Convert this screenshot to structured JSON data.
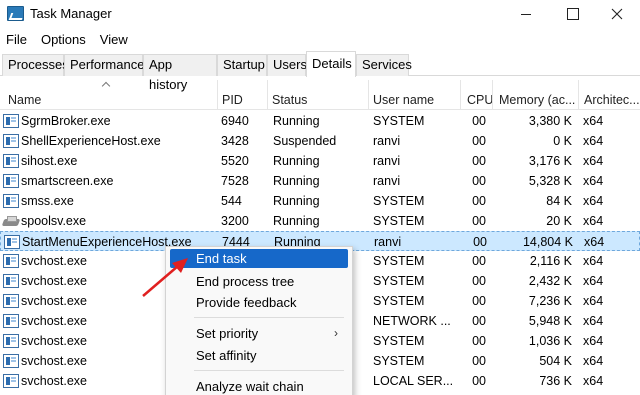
{
  "window": {
    "title": "Task Manager"
  },
  "menu": [
    "File",
    "Options",
    "View"
  ],
  "tabs": [
    {
      "label": "Processes"
    },
    {
      "label": "Performance"
    },
    {
      "label": "App history"
    },
    {
      "label": "Startup"
    },
    {
      "label": "Users"
    },
    {
      "label": "Details",
      "active": true
    },
    {
      "label": "Services"
    }
  ],
  "columns": {
    "name": "Name",
    "pid": "PID",
    "status": "Status",
    "user": "User name",
    "cpu": "CPU",
    "memory": "Memory (ac...",
    "arch": "Architec..."
  },
  "rows": [
    {
      "name": "SgrmBroker.exe",
      "pid": "6940",
      "status": "Running",
      "user": "SYSTEM",
      "cpu": "00",
      "memory": "3,380 K",
      "arch": "x64",
      "icon": "process-icon"
    },
    {
      "name": "ShellExperienceHost.exe",
      "pid": "3428",
      "status": "Suspended",
      "user": "ranvi",
      "cpu": "00",
      "memory": "0 K",
      "arch": "x64",
      "icon": "process-icon"
    },
    {
      "name": "sihost.exe",
      "pid": "5520",
      "status": "Running",
      "user": "ranvi",
      "cpu": "00",
      "memory": "3,176 K",
      "arch": "x64",
      "icon": "process-icon"
    },
    {
      "name": "smartscreen.exe",
      "pid": "7528",
      "status": "Running",
      "user": "ranvi",
      "cpu": "00",
      "memory": "5,328 K",
      "arch": "x64",
      "icon": "process-icon"
    },
    {
      "name": "smss.exe",
      "pid": "544",
      "status": "Running",
      "user": "SYSTEM",
      "cpu": "00",
      "memory": "84 K",
      "arch": "x64",
      "icon": "process-icon"
    },
    {
      "name": "spoolsv.exe",
      "pid": "3200",
      "status": "Running",
      "user": "SYSTEM",
      "cpu": "00",
      "memory": "20 K",
      "arch": "x64",
      "icon": "printer-icon"
    },
    {
      "name": "StartMenuExperienceHost.exe",
      "pid": "7444",
      "status": "Running",
      "user": "ranvi",
      "cpu": "00",
      "memory": "14,804 K",
      "arch": "x64",
      "icon": "process-icon",
      "selected": true
    },
    {
      "name": "svchost.exe",
      "pid": "",
      "status": "",
      "user": "SYSTEM",
      "cpu": "00",
      "memory": "2,116 K",
      "arch": "x64",
      "icon": "process-icon"
    },
    {
      "name": "svchost.exe",
      "pid": "",
      "status": "",
      "user": "SYSTEM",
      "cpu": "00",
      "memory": "2,432 K",
      "arch": "x64",
      "icon": "process-icon"
    },
    {
      "name": "svchost.exe",
      "pid": "",
      "status": "",
      "user": "SYSTEM",
      "cpu": "00",
      "memory": "7,236 K",
      "arch": "x64",
      "icon": "process-icon"
    },
    {
      "name": "svchost.exe",
      "pid": "",
      "status": "",
      "user": "NETWORK ...",
      "cpu": "00",
      "memory": "5,948 K",
      "arch": "x64",
      "icon": "process-icon"
    },
    {
      "name": "svchost.exe",
      "pid": "",
      "status": "",
      "user": "SYSTEM",
      "cpu": "00",
      "memory": "1,036 K",
      "arch": "x64",
      "icon": "process-icon"
    },
    {
      "name": "svchost.exe",
      "pid": "",
      "status": "",
      "user": "SYSTEM",
      "cpu": "00",
      "memory": "504 K",
      "arch": "x64",
      "icon": "process-icon"
    },
    {
      "name": "svchost.exe",
      "pid": "",
      "status": "",
      "user": "LOCAL SER...",
      "cpu": "00",
      "memory": "736 K",
      "arch": "x64",
      "icon": "process-icon"
    }
  ],
  "context_menu": [
    {
      "label": "End task",
      "highlighted": true
    },
    {
      "label": "End process tree"
    },
    {
      "label": "Provide feedback"
    },
    {
      "separator": true
    },
    {
      "label": "Set priority",
      "submenu": true
    },
    {
      "label": "Set affinity"
    },
    {
      "separator": true
    },
    {
      "label": "Analyze wait chain"
    }
  ],
  "colors": {
    "highlight": "#1668c9",
    "selection": "#cce8ff",
    "annotation_arrow": "#e02020"
  }
}
